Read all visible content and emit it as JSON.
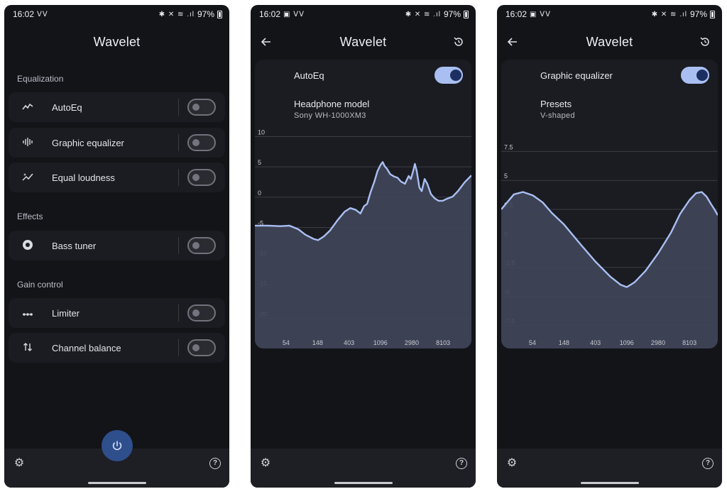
{
  "status": {
    "time": "16:02",
    "battery": "97%",
    "icons_left_1": "ᐯᐯ",
    "icons_left_2": "▣ ᐯᐯ",
    "icons_right": "✱ ✕ ≋ .ıl"
  },
  "app": {
    "title": "Wavelet"
  },
  "main": {
    "sections": [
      {
        "header": "Equalization",
        "items": [
          {
            "label": "AutoEq",
            "icon": "trend-line-icon",
            "enabled": false
          },
          {
            "label": "Graphic equalizer",
            "icon": "waveform-icon",
            "enabled": false
          },
          {
            "label": "Equal loudness",
            "icon": "sparkle-line-icon",
            "enabled": false
          }
        ]
      },
      {
        "header": "Effects",
        "items": [
          {
            "label": "Bass tuner",
            "icon": "speaker-icon",
            "enabled": false
          }
        ]
      },
      {
        "header": "Gain control",
        "items": [
          {
            "label": "Limiter",
            "icon": "dots-line-icon",
            "enabled": false
          },
          {
            "label": "Channel balance",
            "icon": "arrows-updown-icon",
            "enabled": false
          }
        ]
      }
    ]
  },
  "autoeq": {
    "toggle_label": "AutoEq",
    "enabled": true,
    "model_title": "Headphone model",
    "model_value": "Sony WH-1000XM3"
  },
  "graphic_eq": {
    "toggle_label": "Graphic equalizer",
    "enabled": true,
    "presets_title": "Presets",
    "presets_value": "V-shaped"
  },
  "icons": {
    "power": "power-icon",
    "settings": "gear-icon",
    "help": "help-icon",
    "back": "back-arrow-icon",
    "reset": "reset-icon"
  },
  "colors": {
    "background": "#131418",
    "card": "#1b1c21",
    "accent": "#a9bff2",
    "curve_fill": "#404459",
    "fab": "#2e4f8c"
  },
  "chart_data": [
    {
      "type": "area",
      "y_ticks": [
        10,
        5,
        0,
        -5,
        -10,
        -15,
        -20
      ],
      "ylim": [
        -25,
        11
      ],
      "x_ticks": [
        "54",
        "148",
        "403",
        "1096",
        "2980",
        "8103"
      ],
      "x_log": true,
      "xlim": [
        20,
        20000
      ],
      "grid": true,
      "points": [
        [
          20,
          -4.7
        ],
        [
          30,
          -4.7
        ],
        [
          45,
          -4.8
        ],
        [
          60,
          -4.7
        ],
        [
          80,
          -5.3
        ],
        [
          100,
          -6.2
        ],
        [
          130,
          -6.9
        ],
        [
          150,
          -7.1
        ],
        [
          180,
          -6.5
        ],
        [
          220,
          -5.5
        ],
        [
          280,
          -3.8
        ],
        [
          350,
          -2.4
        ],
        [
          420,
          -1.8
        ],
        [
          500,
          -2.1
        ],
        [
          580,
          -2.7
        ],
        [
          650,
          -1.5
        ],
        [
          720,
          -1.1
        ],
        [
          800,
          0.8
        ],
        [
          900,
          2.5
        ],
        [
          1000,
          4.3
        ],
        [
          1100,
          5.3
        ],
        [
          1180,
          5.8
        ],
        [
          1260,
          5.1
        ],
        [
          1350,
          4.7
        ],
        [
          1500,
          3.8
        ],
        [
          1700,
          3.4
        ],
        [
          1900,
          3.2
        ],
        [
          2100,
          2.6
        ],
        [
          2400,
          2.2
        ],
        [
          2700,
          3.5
        ],
        [
          2900,
          3.0
        ],
        [
          3100,
          4.2
        ],
        [
          3300,
          5.5
        ],
        [
          3500,
          4.3
        ],
        [
          3800,
          1.6
        ],
        [
          4100,
          1.0
        ],
        [
          4500,
          3.0
        ],
        [
          4900,
          2.2
        ],
        [
          5500,
          0.5
        ],
        [
          6200,
          -0.2
        ],
        [
          7000,
          -0.6
        ],
        [
          8000,
          -0.6
        ],
        [
          9000,
          -0.3
        ],
        [
          11000,
          0.1
        ],
        [
          13000,
          1.0
        ],
        [
          16000,
          2.4
        ],
        [
          20000,
          3.6
        ]
      ]
    },
    {
      "type": "area",
      "y_ticks": [
        7.5,
        5.0,
        2.5,
        0,
        -2.5,
        -5.0,
        -7.5
      ],
      "ylim": [
        -9.5,
        9.3
      ],
      "x_ticks": [
        "54",
        "148",
        "403",
        "1096",
        "2980",
        "8103"
      ],
      "x_log": true,
      "xlim": [
        20,
        20000
      ],
      "grid": true,
      "points": [
        [
          20,
          2.5
        ],
        [
          30,
          3.8
        ],
        [
          40,
          4.0
        ],
        [
          55,
          3.7
        ],
        [
          75,
          3.1
        ],
        [
          100,
          2.2
        ],
        [
          148,
          1.2
        ],
        [
          250,
          -0.5
        ],
        [
          403,
          -2.0
        ],
        [
          650,
          -3.3
        ],
        [
          900,
          -4.0
        ],
        [
          1096,
          -4.2
        ],
        [
          1400,
          -3.8
        ],
        [
          2000,
          -2.8
        ],
        [
          2980,
          -1.3
        ],
        [
          4500,
          0.5
        ],
        [
          6000,
          2.1
        ],
        [
          8103,
          3.3
        ],
        [
          10000,
          3.9
        ],
        [
          12000,
          4.0
        ],
        [
          14000,
          3.6
        ],
        [
          16000,
          3.0
        ],
        [
          18000,
          2.5
        ],
        [
          20000,
          2.0
        ]
      ]
    }
  ]
}
